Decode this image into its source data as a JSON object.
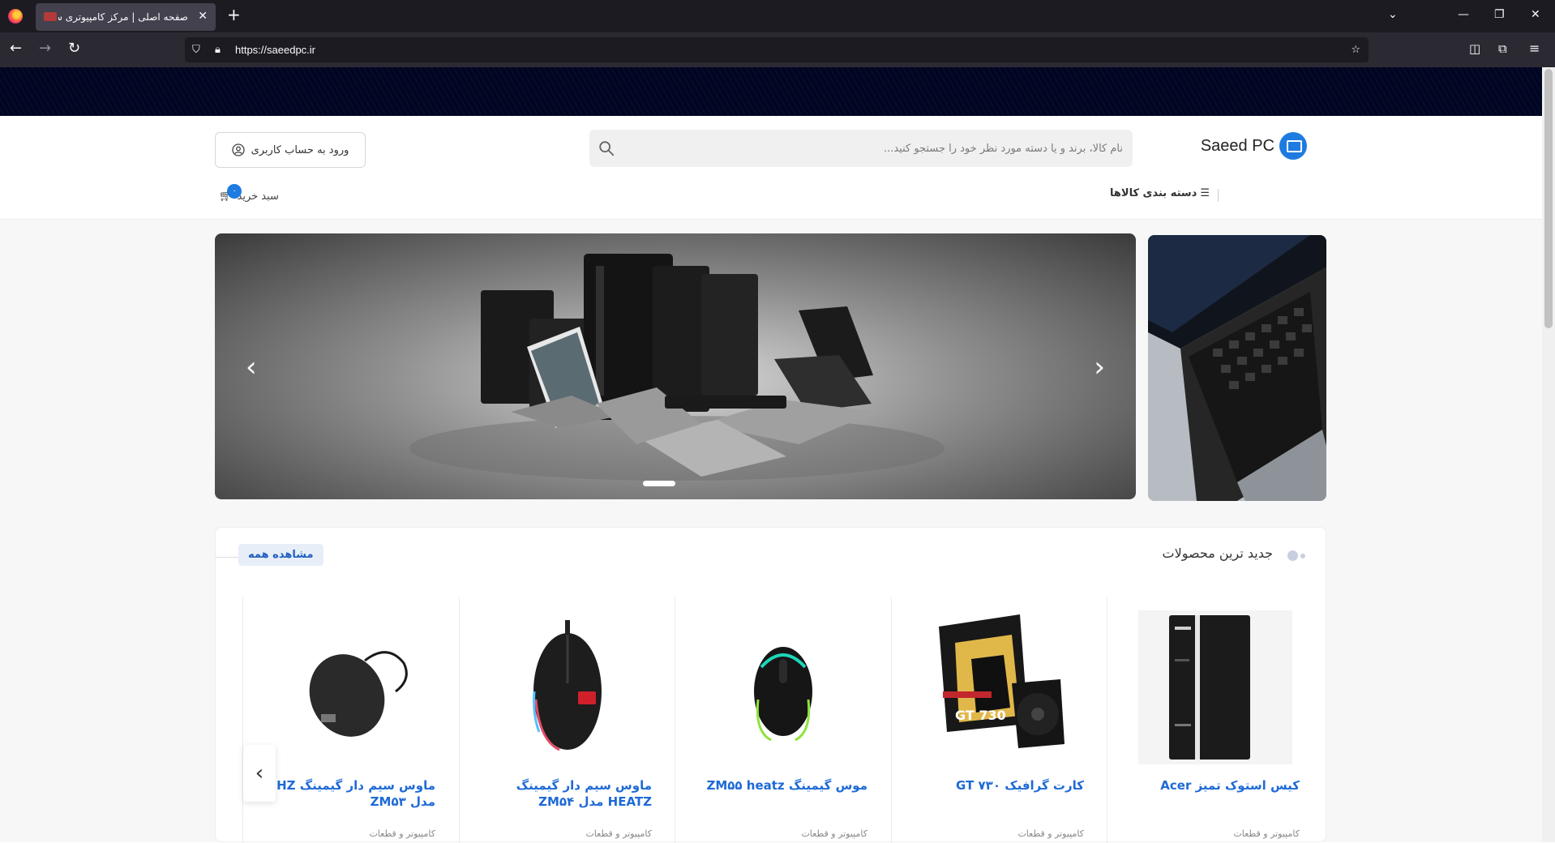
{
  "browser": {
    "tab_title": "صفحه اصلی | مرکز کامپیوتری سعید",
    "url": "https://saeedpc.ir"
  },
  "header": {
    "logo_text": "Saeed PC",
    "search_placeholder": "نام کالا، برند و یا دسته مورد نظر خود را جستجو کنید...",
    "login_label": "ورود به حساب کاربری",
    "categories_label": "دسته بندی کالاها",
    "cart_label": "سبد خرید",
    "cart_count": "۰"
  },
  "section": {
    "title": "جدید ترین محصولات",
    "see_all_label": "مشاهده همه"
  },
  "products": [
    {
      "name": "کیس استوک تمیز Acer",
      "category": "کامپیوتر و قطعات",
      "icon": "pc-case-image"
    },
    {
      "name": "کارت گرافیک GT ۷۳۰",
      "category": "کامپیوتر و قطعات",
      "icon": "graphics-card-image"
    },
    {
      "name": "موس گیمینگ ZM۵۵ heatz",
      "category": "کامپیوتر و قطعات",
      "icon": "gaming-mouse-image"
    },
    {
      "name": "ماوس سیم دار گیمینگ HEATZ مدل ZM۵۴",
      "category": "کامپیوتر و قطعات",
      "icon": "gaming-mouse-image"
    },
    {
      "name": "ماوس سیم دار گیمینگ HZ مدل ZM۵۳",
      "category": "کامپیوتر و قطعات",
      "icon": "wired-mouse-image"
    }
  ],
  "colors": {
    "accent": "#1e7be0",
    "link": "#1e6ad6"
  }
}
